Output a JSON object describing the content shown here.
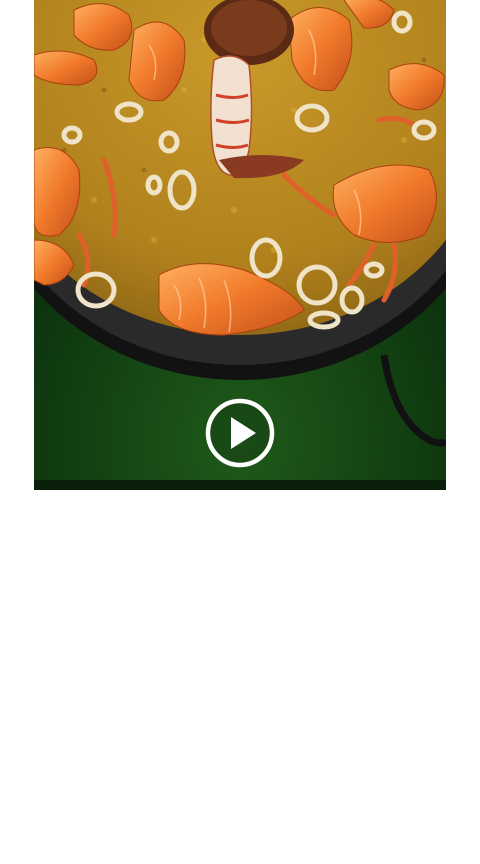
{
  "video": {
    "state": "paused",
    "play_icon": "play-circle-icon",
    "colors": {
      "background_green": "#0f3a10",
      "pan_black": "#1a1a1a",
      "rice_yellow": "#b98a1e",
      "shrimp_orange": "#f07a2a",
      "squid_cream": "#efe3c8"
    }
  }
}
